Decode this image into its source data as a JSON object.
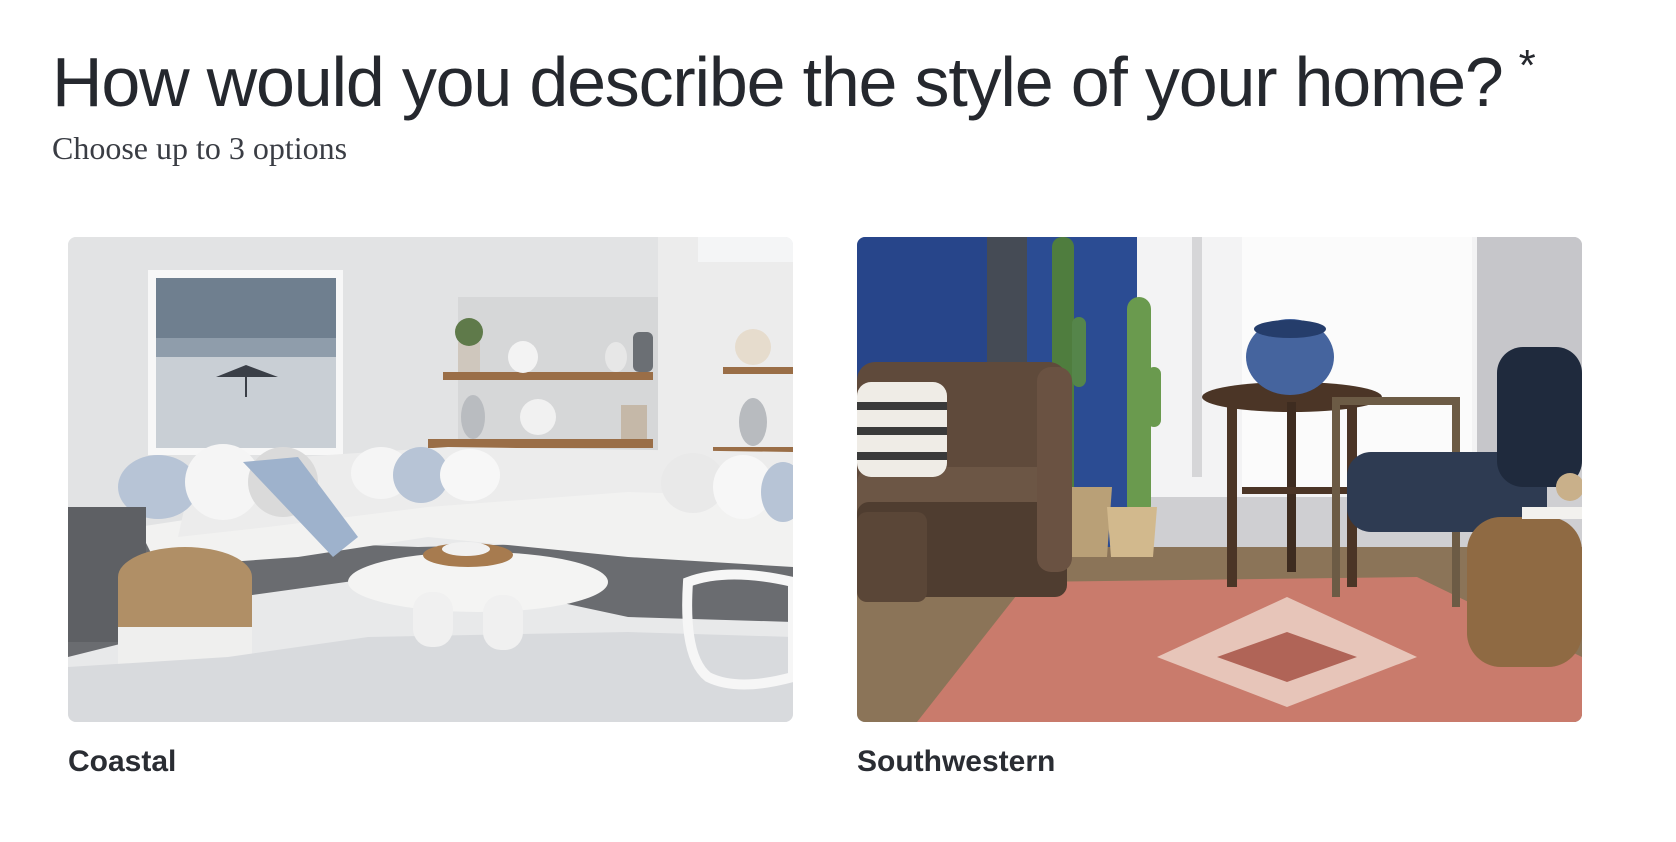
{
  "question": {
    "title": "How would you describe the style of your home?",
    "required_mark": "*",
    "subtitle": "Choose up to 3 options"
  },
  "options": [
    {
      "label": "Coastal",
      "image": "coastal-living-room-photo"
    },
    {
      "label": "Southwestern",
      "image": "southwestern-living-room-photo"
    }
  ]
}
